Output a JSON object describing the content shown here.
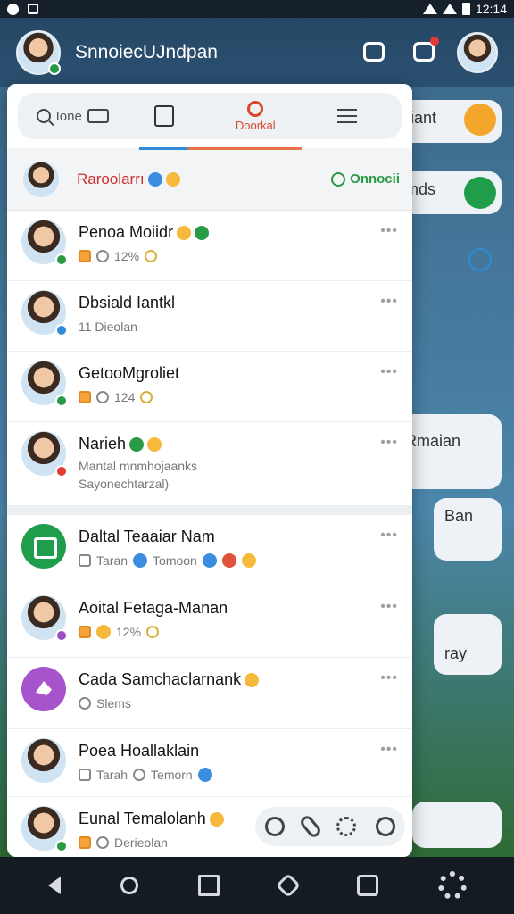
{
  "status_bar": {
    "time": "12:14"
  },
  "app_header": {
    "title": "SnnoiecUJndpan"
  },
  "background": {
    "card1": "riant",
    "card2": "mds",
    "card3": "Rmaian",
    "card4": "Ban",
    "card5": "ray"
  },
  "search": {
    "placeholder_label": "Ione",
    "active_tab_label": "Doorkal"
  },
  "pinned": {
    "name": "Raroolarrı",
    "status": "Onnocii"
  },
  "chats": [
    {
      "name": "Penoa Moiidr",
      "meta": "12%",
      "meta2": ""
    },
    {
      "name": "Dbsiald Iantkl",
      "meta": "11  Dieolan",
      "meta2": ""
    },
    {
      "name": "GetooMgroliet",
      "meta": "124",
      "meta2": ""
    },
    {
      "name": "Narieh",
      "meta": "Mantal mnmhojaanks",
      "meta2": "Sayonechtarzal)"
    }
  ],
  "chats2": [
    {
      "name": "Daltal Teaaiar Nam",
      "meta": "Taran",
      "meta_b": "Tomoon"
    },
    {
      "name": "Aoital Fetaga-Manan",
      "meta": "12%",
      "meta_b": ""
    },
    {
      "name": "Cada Samchaclarnank",
      "meta": "Slems",
      "meta_b": ""
    },
    {
      "name": "Poea Hoallaklain",
      "meta": "Tarah",
      "meta_b": "Temorn"
    },
    {
      "name": "Eunal Temalolanh",
      "meta": "Derieolan",
      "meta_b": ""
    }
  ],
  "colors": {
    "accent_red": "#d9482b",
    "accent_blue": "#2e8bd8",
    "online_green": "#2a9a44"
  }
}
